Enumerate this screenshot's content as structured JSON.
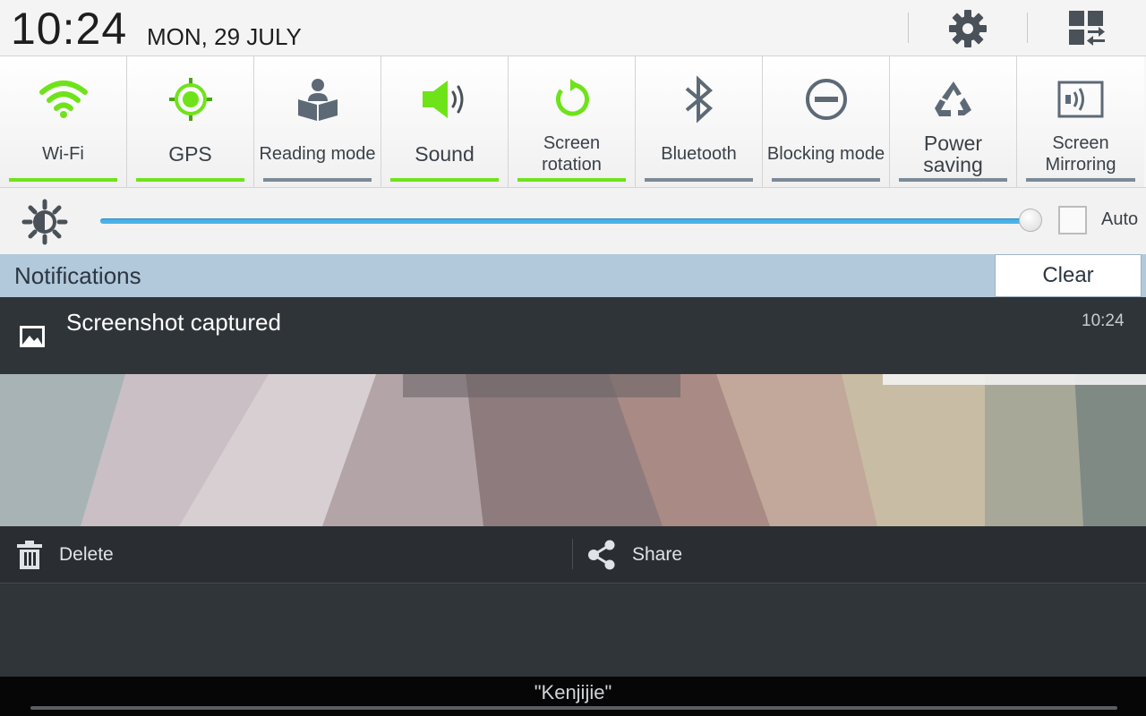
{
  "status": {
    "time": "10:24",
    "date": "MON, 29 JULY"
  },
  "toggles": [
    {
      "label": "Wi-Fi",
      "icon": "wifi-icon",
      "on": true
    },
    {
      "label": "GPS",
      "icon": "gps-icon",
      "on": true
    },
    {
      "label": "Reading mode",
      "icon": "reading-mode-icon",
      "on": false
    },
    {
      "label": "Sound",
      "icon": "sound-icon",
      "on": true
    },
    {
      "label": "Screen rotation",
      "icon": "screen-rotation-icon",
      "on": true
    },
    {
      "label": "Bluetooth",
      "icon": "bluetooth-icon",
      "on": false
    },
    {
      "label": "Blocking mode",
      "icon": "blocking-mode-icon",
      "on": false
    },
    {
      "label": "Power saving",
      "icon": "power-saving-icon",
      "on": false
    },
    {
      "label": "Screen Mirroring",
      "icon": "screen-mirroring-icon",
      "on": false
    }
  ],
  "brightness": {
    "level": 1.0,
    "auto_label": "Auto",
    "auto_checked": false
  },
  "notifications": {
    "title": "Notifications",
    "clear_label": "Clear",
    "items": [
      {
        "title": "Screenshot captured",
        "time": "10:24",
        "actions": {
          "delete": "Delete",
          "share": "Share"
        }
      }
    ]
  },
  "carrier": "\"Kenjijie\"",
  "colors": {
    "toggle_on": "#6fe31a",
    "toggle_off": "#7b8a97",
    "slider": "#4bb2e8",
    "notif_header": "#b2c9db"
  }
}
